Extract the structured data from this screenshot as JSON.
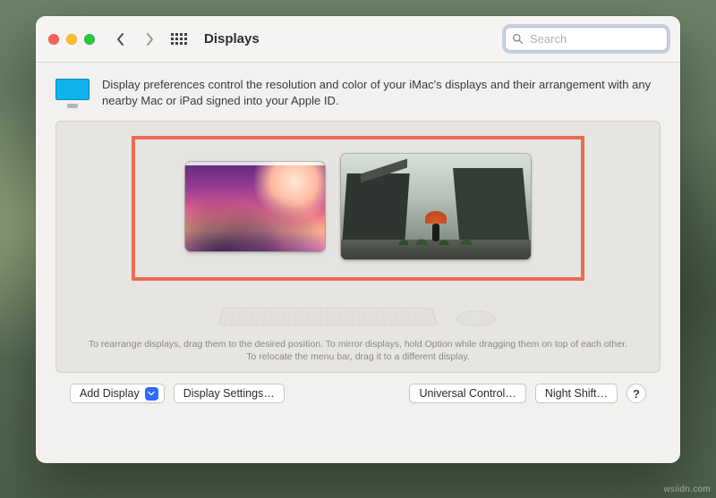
{
  "window": {
    "title": "Displays"
  },
  "search": {
    "placeholder": "Search",
    "value": ""
  },
  "intro": {
    "text": "Display preferences control the resolution and color of your iMac's displays and their arrangement with any nearby Mac or iPad signed into your Apple ID."
  },
  "arrangement": {
    "hint": "To rearrange displays, drag them to the desired position. To mirror displays, hold Option while dragging them on top of each other. To relocate the menu bar, drag it to a different display.",
    "displays": [
      {
        "id": "display-1",
        "primary": true
      },
      {
        "id": "display-2",
        "primary": false
      }
    ]
  },
  "footer": {
    "add_display": "Add Display",
    "display_settings": "Display Settings…",
    "universal_control": "Universal Control…",
    "night_shift": "Night Shift…",
    "help": "?"
  },
  "watermark": "wsiidn.com"
}
